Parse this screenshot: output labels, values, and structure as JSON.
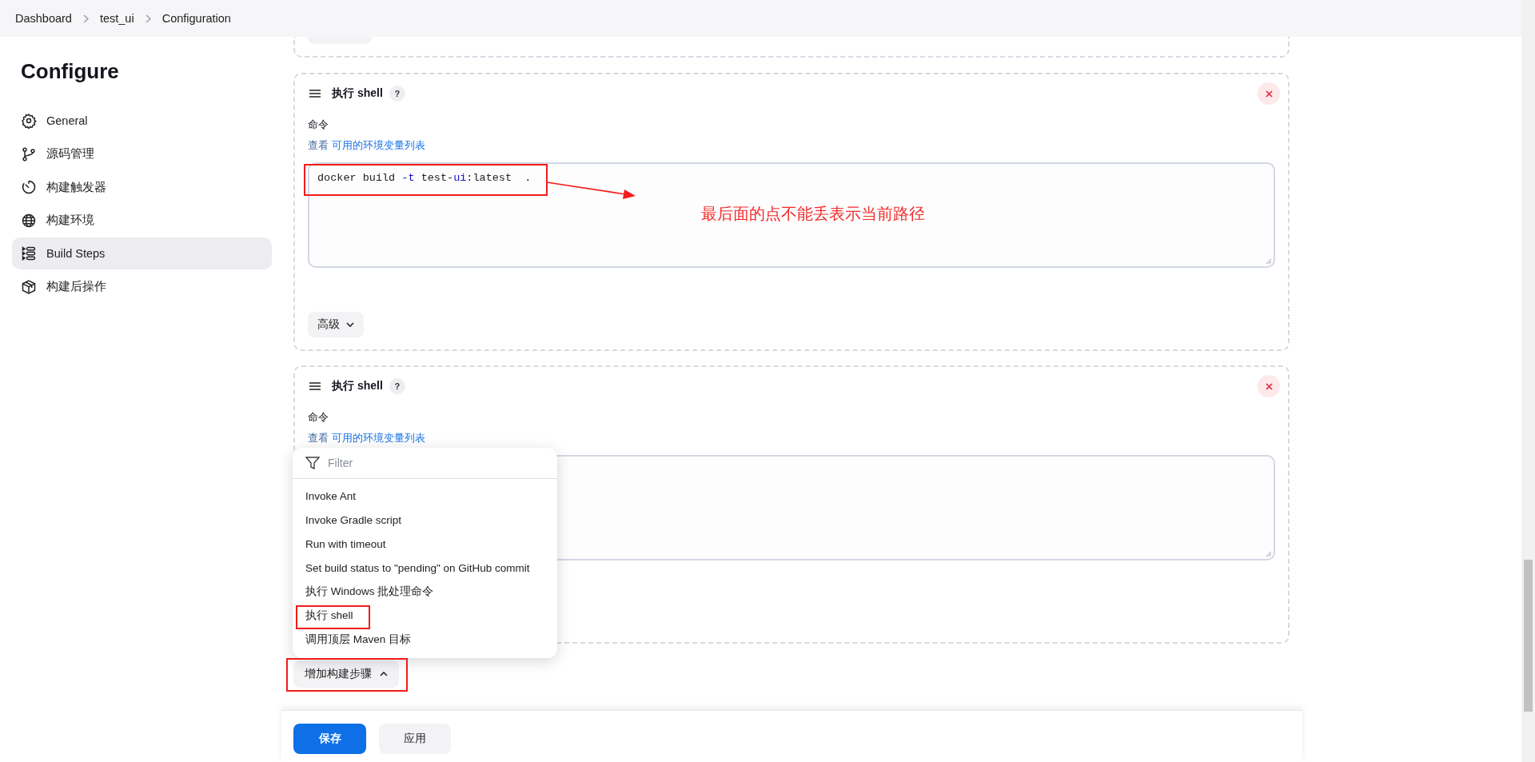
{
  "breadcrumb": [
    {
      "label": "Dashboard"
    },
    {
      "label": "test_ui"
    },
    {
      "label": "Configuration"
    }
  ],
  "sidebar": {
    "title": "Configure",
    "items": [
      {
        "label": "General",
        "kind": "gear",
        "selected": false
      },
      {
        "label": "源码管理",
        "kind": "branch",
        "selected": false
      },
      {
        "label": "构建触发器",
        "kind": "timer",
        "selected": false
      },
      {
        "label": "构建环境",
        "kind": "globe",
        "selected": false
      },
      {
        "label": "Build Steps",
        "kind": "list",
        "selected": true
      },
      {
        "label": "构建后操作",
        "kind": "package",
        "selected": false
      }
    ]
  },
  "build_steps": [
    {
      "title": "执行 shell",
      "help": "?",
      "command_label": "命令",
      "env_prefix": "查看",
      "env_link": "可用的环境变量列表",
      "command_tokens": [
        {
          "text": "docker build ",
          "kind": "plain"
        },
        {
          "text": "-t",
          "kind": "flag"
        },
        {
          "text": " test-",
          "kind": "plain"
        },
        {
          "text": "ui",
          "kind": "flag"
        },
        {
          "text": ":latest  .",
          "kind": "plain"
        }
      ],
      "advanced_button": "高级"
    },
    {
      "title": "执行 shell",
      "help": "?",
      "command_label": "命令",
      "env_prefix": "查看",
      "env_link": "可用的环境变量列表"
    }
  ],
  "add_step_menu": {
    "filter_placeholder": "Filter",
    "items": [
      "Invoke Ant",
      "Invoke Gradle script",
      "Run with timeout",
      "Set build status to \"pending\" on GitHub commit",
      "执行 Windows 批处理命令",
      "执行 shell",
      "调用顶层 Maven 目标"
    ]
  },
  "add_step_button": {
    "label": "增加构建步骤",
    "expanded": true
  },
  "footer": {
    "save": "保存",
    "apply": "应用"
  },
  "annotations": {
    "note": "最后面的点不能丢表示当前路径"
  }
}
